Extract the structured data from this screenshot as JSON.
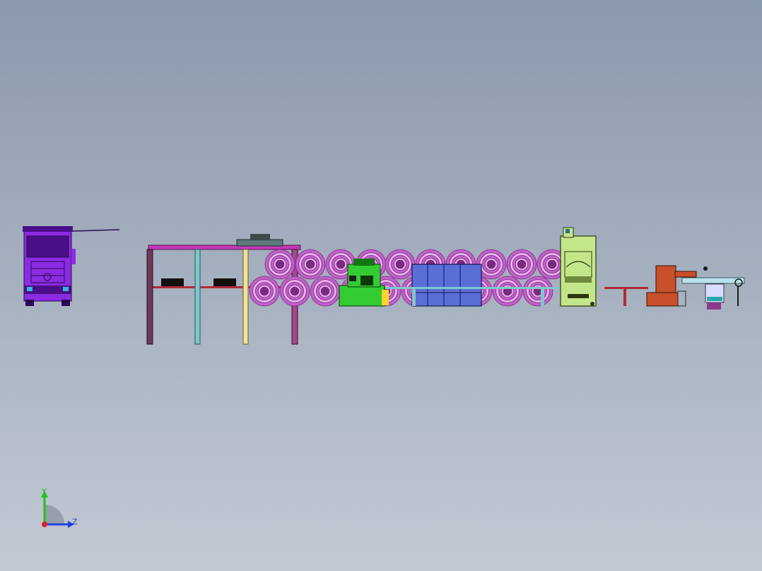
{
  "viewport": {
    "background_top": "#8a99ad",
    "background_bottom": "#c2c9d3"
  },
  "colors": {
    "truck": "#8b2be2",
    "truck_dark": "#4b0f8a",
    "coil": "#c060c8",
    "coil_light": "#e8b2ec",
    "coil_dark": "#7a2a80",
    "frame_top": "#c43ab8",
    "post_dark": "#6a3a58",
    "post_cyan": "#7ec8cc",
    "post_yellow": "#f0e29a",
    "post_pink": "#a0488a",
    "leveler": "#33cc33",
    "leveler_dark": "#117711",
    "feeder": "#5a6ed8",
    "press": "#c4e68a",
    "press_dark": "#6d8a3a",
    "conveyor": "#b02a3a",
    "stacker": "#c8502a",
    "outlet": "#b9e2ea",
    "axis_x": "#e02020",
    "axis_y": "#20c020",
    "axis_z": "#2040e0"
  },
  "axis_triad": {
    "y_label": "Y",
    "z_label": "Z"
  }
}
